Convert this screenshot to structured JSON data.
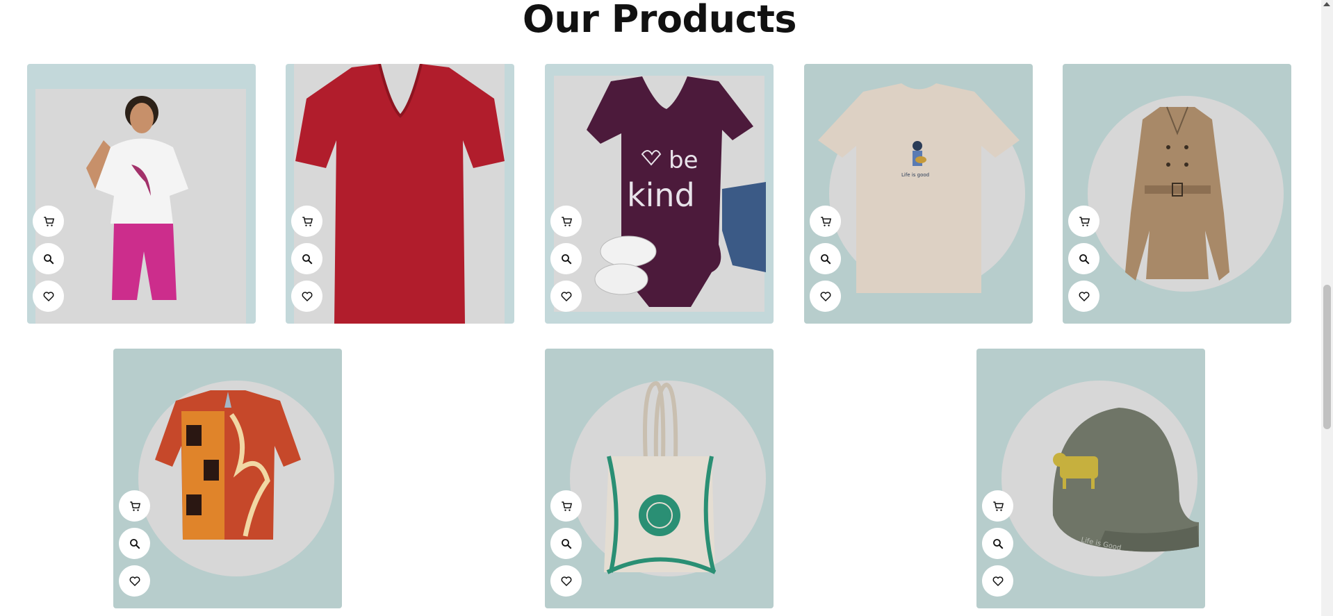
{
  "section": {
    "title": "Our Products"
  },
  "icons": {
    "cart": "cart-icon",
    "zoom": "search-icon",
    "wishlist": "heart-icon"
  },
  "products": [
    {
      "image": "woman-in-white-puma-tee-image",
      "bg": "#c3d8da"
    },
    {
      "image": "red-v-neck-tee-image",
      "bg": "#c3d8da"
    },
    {
      "image": "purple-be-kind-tee-image",
      "bg": "#c3d8da"
    },
    {
      "image": "beige-life-is-good-tee-image",
      "bg": "#b7cdcc"
    },
    {
      "image": "tan-trench-coat-image",
      "bg": "#b7cdcc"
    },
    {
      "image": "patterned-camp-shirt-image",
      "bg": "#b7cdcc"
    },
    {
      "image": "canvas-tote-bag-image",
      "bg": "#b7cdcc"
    },
    {
      "image": "gray-cat-cap-image",
      "bg": "#b7cdcc"
    }
  ]
}
